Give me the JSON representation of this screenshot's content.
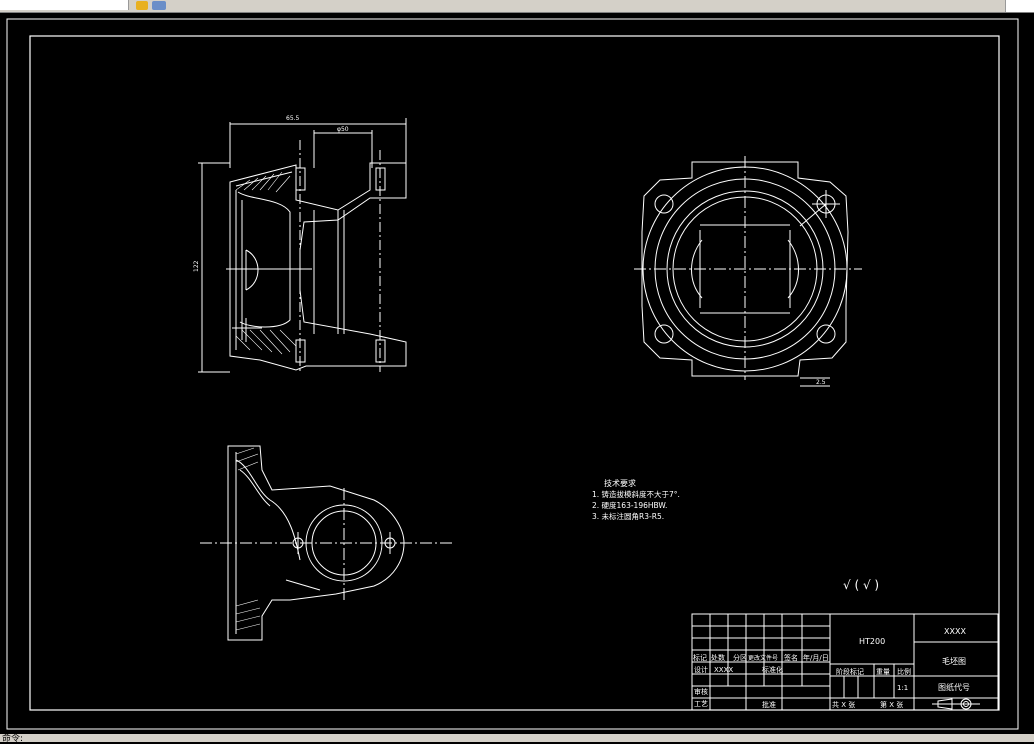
{
  "window": {
    "status_text": "命令:"
  },
  "drawing": {
    "dim_width": "65.5",
    "dim_inner": "φ50",
    "dim_height": "122",
    "dim_small": "2.5",
    "roughness_mark": "√ ( √ )",
    "tech_notes": {
      "title": "技术要求",
      "items": [
        "1. 铸造拔模斜度不大于7°.",
        "2. 硬度163-196HBW.",
        "3. 未标注圆角R3-R5."
      ]
    }
  },
  "title_block": {
    "material": "HT200",
    "company": "XXXX",
    "drawing_name": "毛坯图",
    "drawing_code": "图纸代号",
    "row_labels": [
      "标记",
      "处数",
      "分区",
      "更改文件号",
      "签名",
      "年/月/日"
    ],
    "designer_label": "设计",
    "designer_name": "XXXX",
    "standardize_label": "标准化",
    "stage_mark": "阶段标记",
    "weight": "重量",
    "scale_label": "比例",
    "scale": "1:1",
    "review_label": "审核",
    "process_label": "工艺",
    "approve_label": "批准",
    "total_sheets": "共 X 张",
    "sheet_no": "第 X 张"
  }
}
